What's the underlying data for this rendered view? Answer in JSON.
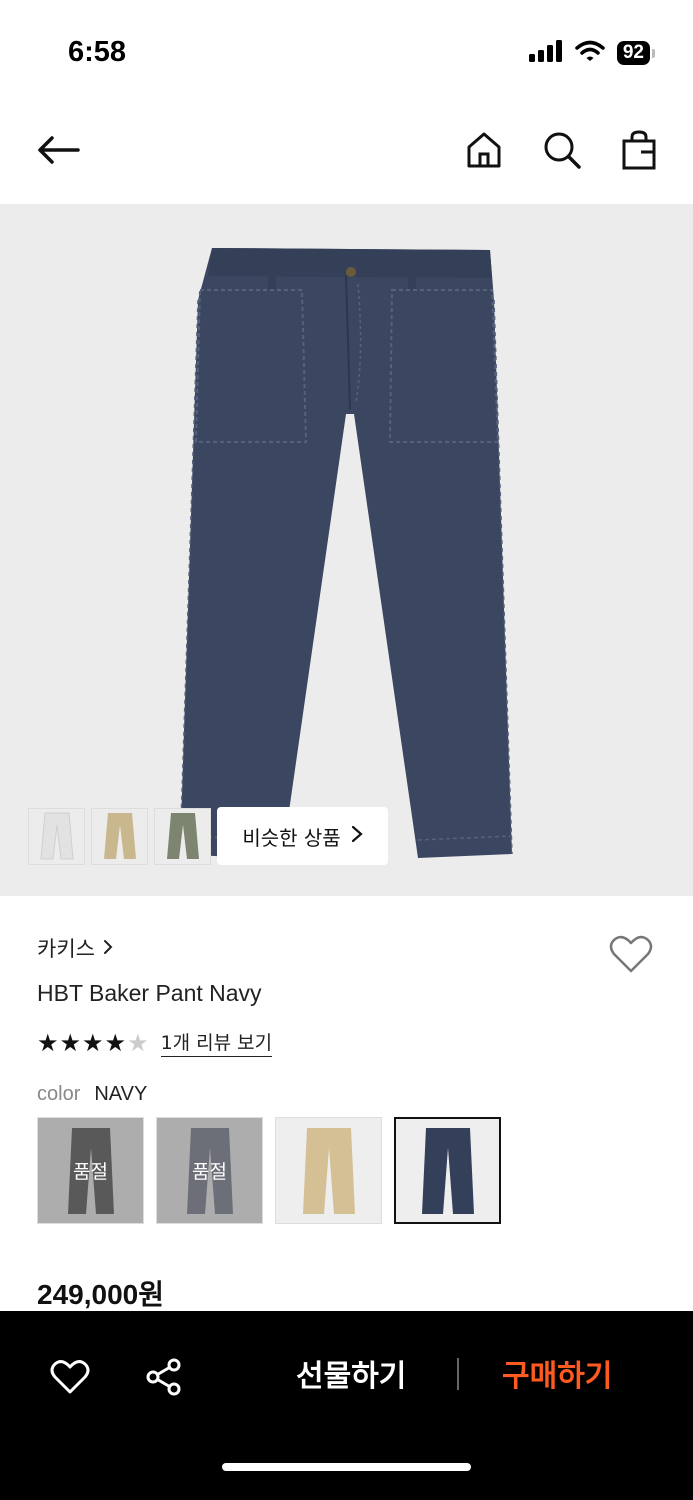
{
  "status": {
    "time": "6:58",
    "battery": "92"
  },
  "nav": {
    "back_icon": "arrow-left-icon",
    "home_icon": "home-icon",
    "search_icon": "search-icon",
    "bag_icon": "shopping-bag-icon"
  },
  "gallery": {
    "similar_label": "비슷한 상품",
    "thumb_colors": [
      "#e2e2e2",
      "#c9b78e",
      "#7d8570"
    ]
  },
  "product": {
    "brand": "카키스",
    "name": "HBT Baker Pant Navy",
    "rating": 4,
    "rating_max": 5,
    "review_link": "1개 리뷰 보기",
    "color_label": "color",
    "color_value": "NAVY",
    "price": "249,000원"
  },
  "swatches": [
    {
      "color": "#333333",
      "soldout": true,
      "label": "품절"
    },
    {
      "color": "#5e6478",
      "soldout": true,
      "label": "품절"
    },
    {
      "color": "#d4c094",
      "soldout": false,
      "label": ""
    },
    {
      "color": "#34405a",
      "soldout": false,
      "label": "",
      "selected": true
    }
  ],
  "colors": {
    "accent": "#ff5a1f",
    "navy": "#3b4660"
  },
  "bottom_bar": {
    "wish_icon": "heart-icon",
    "share_icon": "share-icon",
    "gift_label": "선물하기",
    "buy_label": "구매하기"
  }
}
